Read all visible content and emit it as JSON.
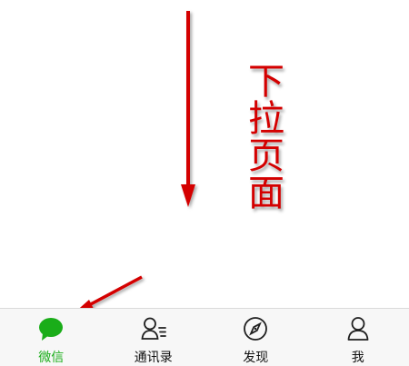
{
  "annotation": {
    "chars": [
      "下",
      "拉",
      "页",
      "面"
    ],
    "color": "#d40000"
  },
  "tabbar": {
    "accent_color": "#1aad19",
    "active_index": 0,
    "tabs": [
      {
        "label": "微信",
        "icon": "chat-bubble-icon"
      },
      {
        "label": "通讯录",
        "icon": "contacts-icon"
      },
      {
        "label": "发现",
        "icon": "compass-icon"
      },
      {
        "label": "我",
        "icon": "profile-icon"
      }
    ]
  }
}
